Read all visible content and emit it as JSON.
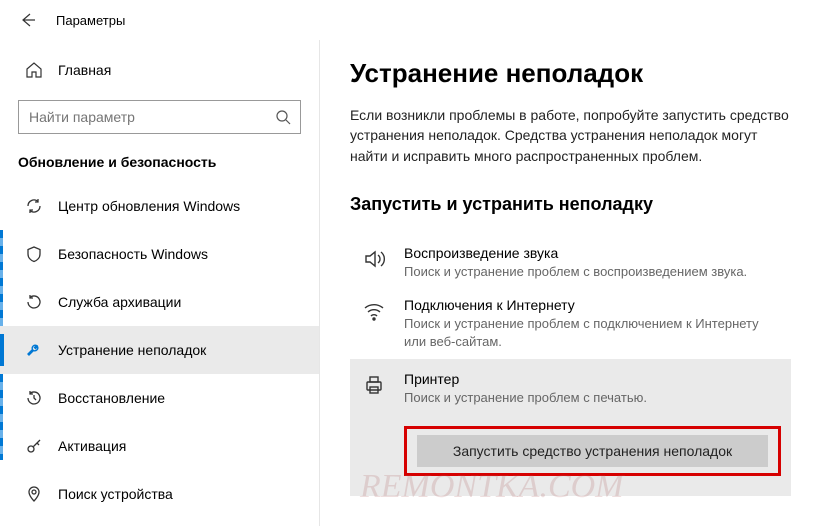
{
  "titlebar": {
    "title": "Параметры"
  },
  "sidebar": {
    "home": "Главная",
    "search_placeholder": "Найти параметр",
    "section": "Обновление и безопасность",
    "items": [
      {
        "label": "Центр обновления Windows"
      },
      {
        "label": "Безопасность Windows"
      },
      {
        "label": "Служба архивации"
      },
      {
        "label": "Устранение неполадок"
      },
      {
        "label": "Восстановление"
      },
      {
        "label": "Активация"
      },
      {
        "label": "Поиск устройства"
      }
    ]
  },
  "main": {
    "heading": "Устранение неполадок",
    "lead": "Если возникли проблемы в работе, попробуйте запустить средство устранения неполадок. Средства устранения неполадок могут найти и исправить много распространенных проблем.",
    "subheading": "Запустить и устранить неполадку",
    "items": [
      {
        "title": "Воспроизведение звука",
        "desc": "Поиск и устранение проблем с воспроизведением звука."
      },
      {
        "title": "Подключения к Интернету",
        "desc": "Поиск и устранение проблем с подключением к Интернету или веб-сайтам."
      },
      {
        "title": "Принтер",
        "desc": "Поиск и устранение проблем с печатью."
      }
    ],
    "run_button": "Запустить средство устранения неполадок"
  }
}
